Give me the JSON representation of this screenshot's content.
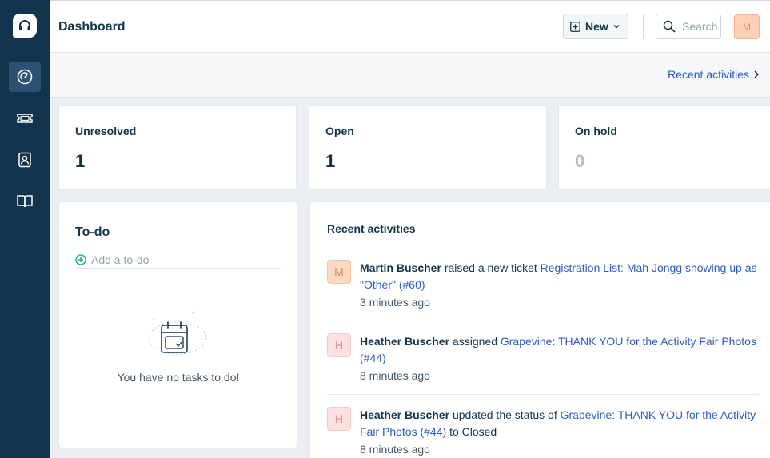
{
  "header": {
    "title": "Dashboard",
    "new_label": "New",
    "search_placeholder": "Search",
    "avatar_initial": "M"
  },
  "subheader": {
    "recent_link": "Recent activities"
  },
  "stats": [
    {
      "label": "Unresolved",
      "value": "1"
    },
    {
      "label": "Open",
      "value": "1"
    },
    {
      "label": "On hold",
      "value": "0"
    }
  ],
  "todo": {
    "title": "To-do",
    "add_placeholder": "Add a to-do",
    "empty_text": "You have no tasks to do!"
  },
  "activities": {
    "title": "Recent activities",
    "items": [
      {
        "initial": "M",
        "actor": "Martin Buscher",
        "action": "raised a new ticket",
        "link": "Registration List: Mah Jongg showing up as \"Other\" (#60)",
        "suffix": "",
        "time": "3 minutes ago"
      },
      {
        "initial": "H",
        "actor": "Heather Buscher",
        "action": "assigned",
        "link": "Grapevine: THANK YOU for the Activity Fair Photos (#44)",
        "suffix": "",
        "time": "8 minutes ago"
      },
      {
        "initial": "H",
        "actor": "Heather Buscher",
        "action": "updated the status of",
        "link": "Grapevine: THANK YOU for the Activity Fair Photos (#44)",
        "suffix": "to Closed",
        "time": "8 minutes ago"
      }
    ]
  },
  "sidebar": {
    "items": [
      {
        "icon": "dashboard-gauge-icon"
      },
      {
        "icon": "ticket-icon"
      },
      {
        "icon": "contacts-icon"
      },
      {
        "icon": "knowledge-base-book-icon"
      }
    ]
  },
  "colors": {
    "sidebar_bg": "#12344d",
    "link": "#2c5cc5",
    "avatar_orange": "#ffd9c2",
    "avatar_pink": "#ffe1e1"
  }
}
